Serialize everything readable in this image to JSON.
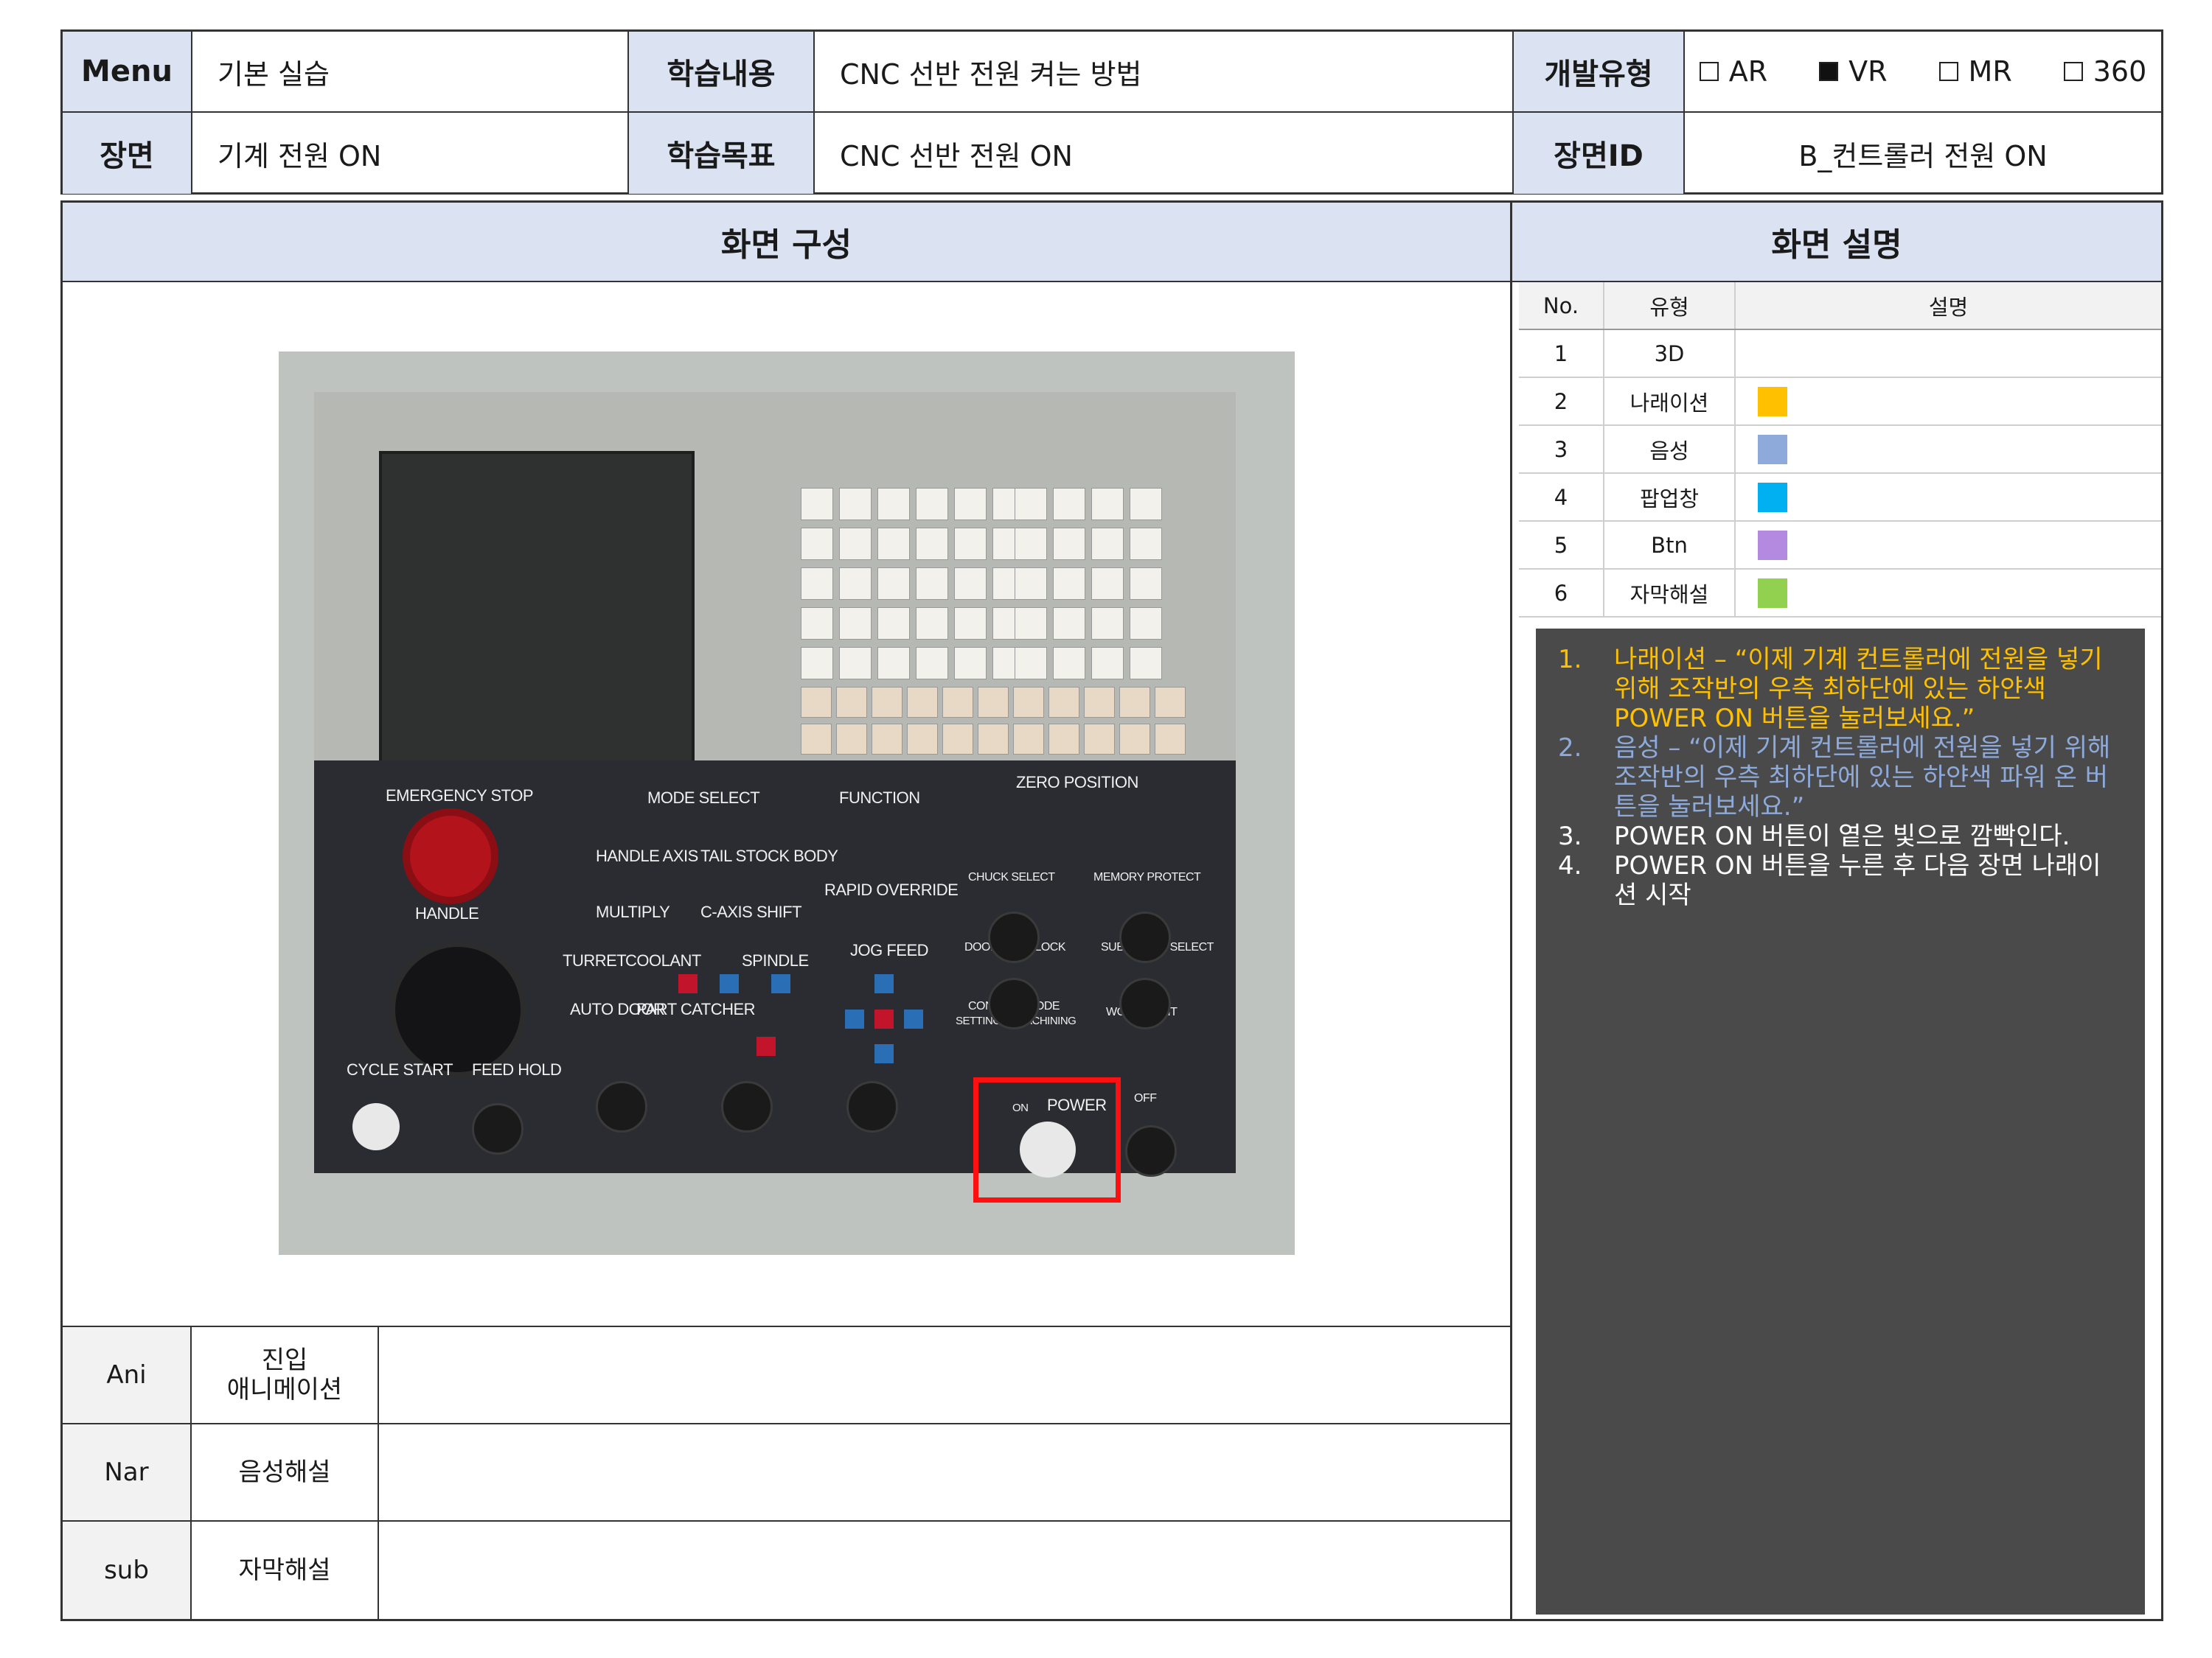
{
  "header": {
    "menu_label": "Menu",
    "menu_value": "기본 실습",
    "content_label": "학습내용",
    "content_value": "CNC 선반 전원 켜는 방법",
    "devtype_label": "개발유형",
    "devtype_options": [
      {
        "label": "AR",
        "checked": false
      },
      {
        "label": "VR",
        "checked": true
      },
      {
        "label": "MR",
        "checked": false
      },
      {
        "label": "360",
        "checked": false
      }
    ],
    "scene_label": "장면",
    "scene_value": "기계 전원 ON",
    "goal_label": "학습목표",
    "goal_value": "CNC 선반 전원 ON",
    "sceneid_label": "장면ID",
    "sceneid_value": "B_컨트롤러 전원 ON"
  },
  "sections": {
    "composition_title": "화면 구성",
    "description_title": "화면 설명"
  },
  "legend": {
    "headers": {
      "no": "No.",
      "type": "유형",
      "desc": "설명"
    },
    "rows": [
      {
        "no": "1",
        "type": "3D",
        "color": ""
      },
      {
        "no": "2",
        "type": "나래이션",
        "color": "#ffc000"
      },
      {
        "no": "3",
        "type": "음성",
        "color": "#8eaadb"
      },
      {
        "no": "4",
        "type": "팝업창",
        "color": "#00b0f0"
      },
      {
        "no": "5",
        "type": "Btn",
        "color": "#b48ae0"
      },
      {
        "no": "6",
        "type": "자막해설",
        "color": "#92d050"
      }
    ]
  },
  "notes": [
    {
      "num": "1.",
      "text": "나래이션 – “이제 기계 컨트롤러에 전원을 넣기 위해 조작반의 우측 최하단에 있는 하얀색 POWER ON 버튼을 눌러보세요.”",
      "color": "#ffc000"
    },
    {
      "num": "2.",
      "text": "음성 – “이제 기계 컨트롤러에 전원을 넣기 위해 조작반의 우측 최하단에 있는 하얀색 파워 온 버튼을 눌러보세요.”",
      "color": "#8eaadb"
    },
    {
      "num": "3.",
      "text": "POWER ON 버튼이 옅은 빛으로 깜빡인다.",
      "color": "#ffffff"
    },
    {
      "num": "4.",
      "text": "POWER ON 버튼을 누른 후 다음 장면 나래이션 시작",
      "color": "#ffffff"
    }
  ],
  "bottom_rows": [
    {
      "key": "Ani",
      "title": "진입\n애니메이션",
      "value": ""
    },
    {
      "key": "Nar",
      "title": "음성해설",
      "value": ""
    },
    {
      "key": "sub",
      "title": "자막해설",
      "value": ""
    }
  ],
  "screenshot": {
    "labels": {
      "emergency_stop": "EMERGENCY STOP",
      "handle": "HANDLE",
      "mode_select": "MODE SELECT",
      "function": "FUNCTION",
      "zero_position": "ZERO POSITION",
      "handle_axis": "HANDLE AXIS",
      "tail_stock_body": "TAIL STOCK BODY",
      "rapid_override": "RAPID OVERRIDE",
      "multiply": "MULTIPLY",
      "c_axis_shift": "C-AXIS SHIFT",
      "turret": "TURRET",
      "coolant": "COOLANT",
      "spindle": "SPINDLE",
      "jog_feed": "JOG FEED",
      "auto_door": "AUTO DOOR",
      "part_catcher": "PART CATCHER",
      "chuck_select": "CHUCK SELECT",
      "memory_protect": "MEMORY PROTECT",
      "door_interlock": "DOOR INTERLOCK",
      "sub_chuck_select": "SUB CHUCK SELECT",
      "control_mode": "CONTROL MODE",
      "setting": "SETTING",
      "machining": "MACHINING",
      "work_light": "WORK LIGHT",
      "cycle_start": "CYCLE START",
      "feed_hold": "FEED HOLD",
      "power": "POWER",
      "on": "ON",
      "off": "OFF"
    }
  }
}
